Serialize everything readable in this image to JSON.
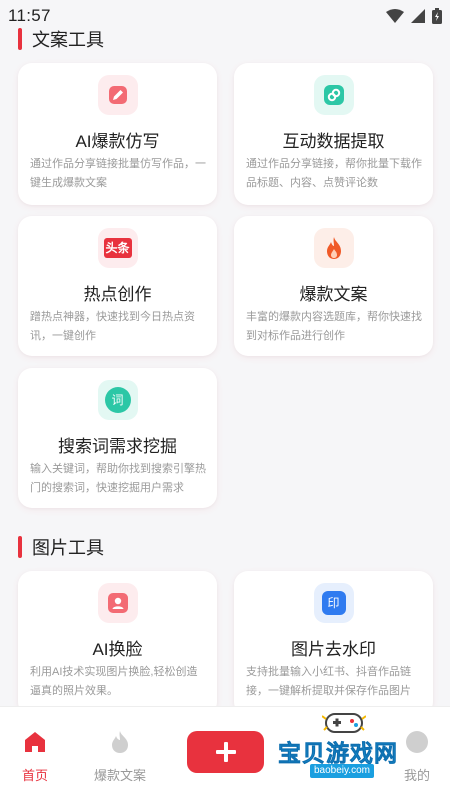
{
  "status_bar": {
    "time": "11:57"
  },
  "sections": {
    "copy_tools": {
      "title": "文案工具"
    },
    "image_tools": {
      "title": "图片工具"
    }
  },
  "cards": {
    "ai_imitate": {
      "title": "AI爆款仿写",
      "desc": "通过作品分享链接批量仿写作品，一键生成爆款文案",
      "icon": "pencil-icon",
      "color": "#e8323e"
    },
    "data_extract": {
      "title": "互动数据提取",
      "desc": "通过作品分享链接，帮你批量下载作品标题、内容、点赞评论数",
      "icon": "link-icon",
      "color": "#1cbfa0"
    },
    "hot_create": {
      "title": "热点创作",
      "desc": "蹭热点神器，快速找到今日热点资讯，一键创作",
      "icon": "toutiao-icon",
      "icon_text": "头条",
      "color": "#e8323e"
    },
    "hot_copy": {
      "title": "爆款文案",
      "desc": "丰富的爆款内容选题库，帮你快速找到对标作品进行创作",
      "icon": "fire-icon",
      "color": "#f05a28"
    },
    "keyword_mining": {
      "title": "搜索词需求挖掘",
      "desc": "输入关键词，帮助你找到搜索引擎热门的搜索词，快速挖掘用户需求",
      "icon": "search-word-icon",
      "icon_text": "词",
      "color": "#1cbfa0"
    },
    "ai_faceswap": {
      "title": "AI换脸",
      "desc": "利用AI技术实现图片换脸,轻松创造逼真的照片效果。",
      "icon": "face-scan-icon",
      "color": "#e8323e"
    },
    "watermark_remove": {
      "title": "图片去水印",
      "desc": "支持批量输入小红书、抖音作品链接，一键解析提取并保存作品图片",
      "icon": "stamp-icon",
      "icon_text": "印",
      "color": "#2f7bf0"
    }
  },
  "bottom_nav": {
    "home": {
      "label": "首页"
    },
    "hot_copy": {
      "label": "爆款文案"
    },
    "mine": {
      "label": "我的"
    },
    "accent": "#e8323e"
  },
  "watermark": {
    "text": "宝贝游戏网",
    "url": "baobeiy.com"
  }
}
